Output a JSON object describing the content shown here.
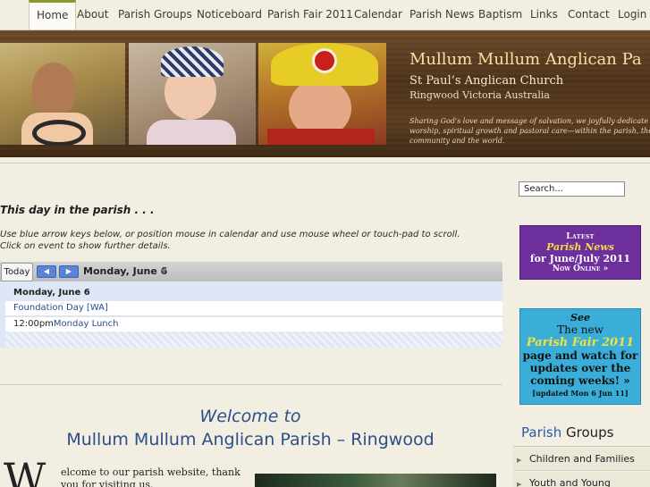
{
  "nav": {
    "items": [
      "Home",
      "About",
      "Parish Groups",
      "Noticeboard",
      "Parish Fair 2011",
      "Calendar",
      "Parish News",
      "Baptism",
      "Links",
      "Contact",
      "Login"
    ]
  },
  "banner": {
    "title": "Mullum Mullum Anglican Pa",
    "church": "St Paul’s Anglican Church",
    "location": "Ringwood Victoria Australia",
    "tagline": "Sharing God's love and message of salvation, we joyfully dedicate to worship, spiritual growth and pastoral care—within the parish, the local community and the world."
  },
  "main": {
    "day_heading": "This day in the parish . . .",
    "help_line1": "Use blue arrow keys below, or position mouse in calendar and use mouse wheel or touch-pad to scroll.",
    "help_line2": "Click on event to show further details.",
    "calendar": {
      "today_label": "Today",
      "prev_arrow": "◀",
      "next_arrow": "▶",
      "date_label": "Monday, June 6",
      "caret": "▼",
      "day_heading": "Monday, June 6",
      "events": [
        {
          "time": "",
          "title": "Foundation Day [WA]"
        },
        {
          "time": "12:00pm",
          "title": "Monday Lunch"
        }
      ]
    },
    "welcome_line1": "Welcome to",
    "welcome_line2": "Mullum Mullum Anglican Parish – Ringwood",
    "dropcap": "W",
    "intro_bold": "elcome",
    "intro_rest": " to our parish website, thank you for visiting us."
  },
  "sidebar": {
    "search_value": "Search...",
    "news_box": {
      "line1": "Latest",
      "line2": "Parish News",
      "line3": "for June/July 2011",
      "line4": "Now Online »"
    },
    "fair_box": {
      "line1": "See",
      "line2": "The new",
      "line3": "Parish Fair 2011",
      "line4": "page and watch for updates over the coming weeks! »",
      "line5": "[updated Mon 6 Jun 11]"
    },
    "groups": {
      "title_blue": "Parish",
      "title_rest": " Groups",
      "items": [
        "Children and Families",
        "Youth and Young"
      ]
    }
  },
  "colors": {
    "nav_active_accent": "#8a9a2f",
    "link_blue": "#2a4f8a",
    "news_box": "#6c2f9b",
    "fair_box": "#3aaed9"
  }
}
